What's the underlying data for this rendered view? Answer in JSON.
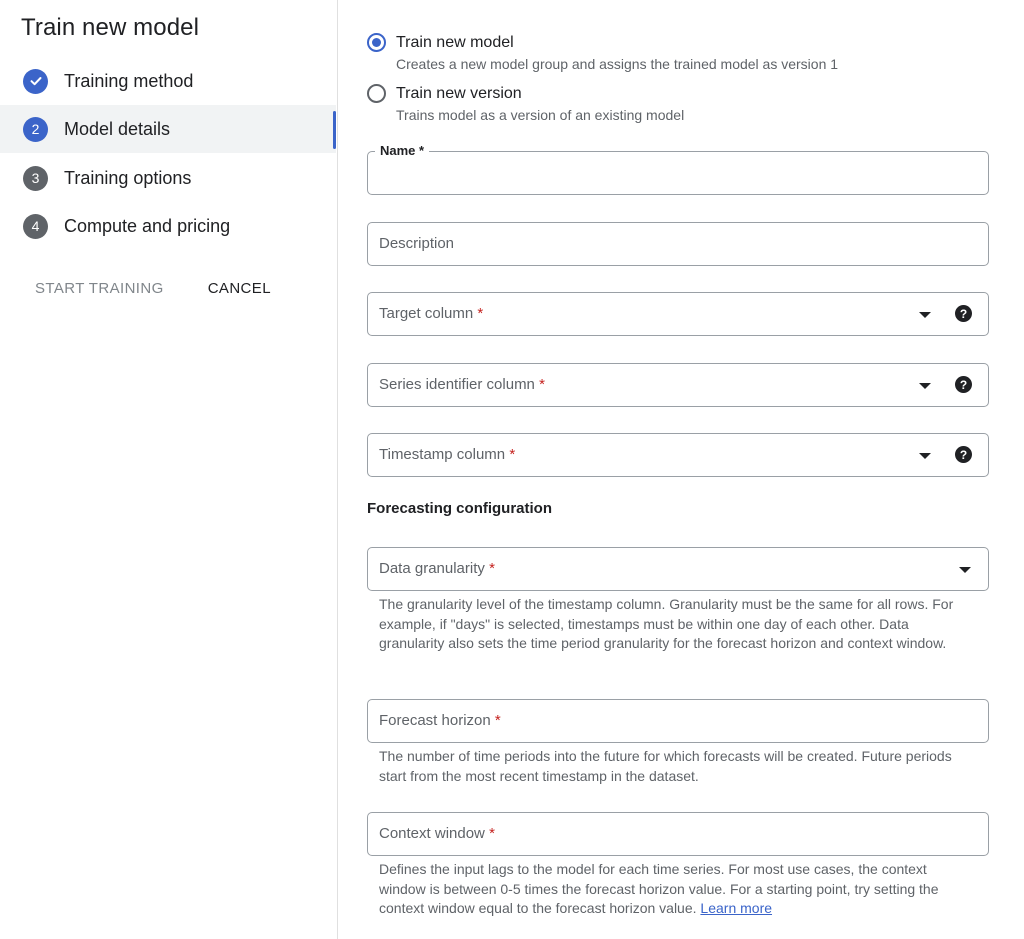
{
  "sidebar": {
    "title": "Train new model",
    "steps": [
      {
        "number": "",
        "label": "Training method",
        "state": "done",
        "icon": "checkmark-icon"
      },
      {
        "number": "2",
        "label": "Model details",
        "state": "active"
      },
      {
        "number": "3",
        "label": "Training options",
        "state": "todo"
      },
      {
        "number": "4",
        "label": "Compute and pricing",
        "state": "todo"
      }
    ],
    "start_training_label": "START TRAINING",
    "cancel_label": "CANCEL"
  },
  "form": {
    "options": [
      {
        "label": "Train new model",
        "description": "Creates a new model group and assigns the trained model as version 1",
        "selected": true
      },
      {
        "label": "Train new version",
        "description": "Trains model as a version of an existing model",
        "selected": false
      }
    ],
    "name": {
      "label": "Name",
      "required_mark": "*",
      "value": ""
    },
    "description": {
      "label": "Description",
      "value": ""
    },
    "target_column": {
      "label": "Target column",
      "required_mark": "*",
      "help_icon": "help-icon"
    },
    "series_identifier_column": {
      "label": "Series identifier column",
      "required_mark": "*",
      "help_icon": "help-icon"
    },
    "timestamp_column": {
      "label": "Timestamp column",
      "required_mark": "*",
      "help_icon": "help-icon"
    },
    "forecasting_configuration": {
      "title": "Forecasting configuration",
      "data_granularity": {
        "label": "Data granularity",
        "required_mark": "*",
        "helper": "The granularity level of the timestamp column. Granularity must be the same for all rows. For example, if \"days\" is selected, timestamps must be within one day of each other. Data granularity also sets the time period granularity for the forecast horizon and context window."
      },
      "forecast_horizon": {
        "label": "Forecast horizon",
        "required_mark": "*",
        "helper": "The number of time periods into the future for which forecasts will be created. Future periods start from the most recent timestamp in the dataset."
      },
      "context_window": {
        "label": "Context window",
        "required_mark": "*",
        "helper": "Defines the input lags to the model for each time series. For most use cases, the context window is between 0-5 times the forecast horizon value. For a starting point, try setting the context window equal to the forecast horizon value.",
        "link_text": "Learn more"
      }
    }
  },
  "colors": {
    "accent": "#3b64c9",
    "required": "#c5221f",
    "muted_text": "#5f6368",
    "step_inactive": "#5f6368"
  }
}
